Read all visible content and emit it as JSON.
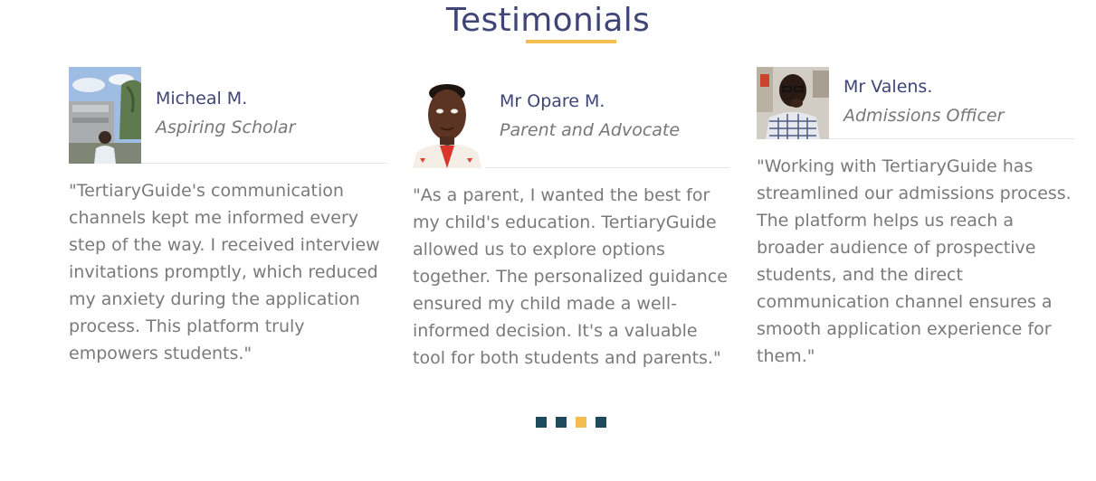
{
  "section": {
    "title": "Testimonials",
    "accent_color": "#f5bd4f",
    "title_color": "#3f4577"
  },
  "testimonials": [
    {
      "name": "Micheal M.",
      "role": "Aspiring Scholar",
      "photo": "photo of a man standing outdoors in front of a building",
      "quote": "\"TertiaryGuide's communication channels kept me informed every step of the way. I received interview invitations promptly, which reduced my anxiety during the application process. This platform truly empowers students.\""
    },
    {
      "name": "Mr Opare M.",
      "role": "Parent and Advocate",
      "photo": "portrait photo of a man on a white background",
      "quote": "\"As a parent, I wanted the best for my child's education. TertiaryGuide allowed us to explore options together. The personalized guidance ensured my child made a well-informed decision. It's a valuable tool for both students and parents.\""
    },
    {
      "name": "Mr Valens.",
      "role": "Admissions Officer",
      "photo": "photo of a man in a plaid shirt seated indoors",
      "quote": "\"Working with TertiaryGuide has streamlined our admissions process. The platform helps us reach a broader audience of prospective students, and the direct communication channel ensures a smooth application experience for them.\""
    }
  ],
  "pager": {
    "total": 4,
    "active_index": 2,
    "color": "#1f4b5e",
    "active_color": "#f5bd4f"
  }
}
